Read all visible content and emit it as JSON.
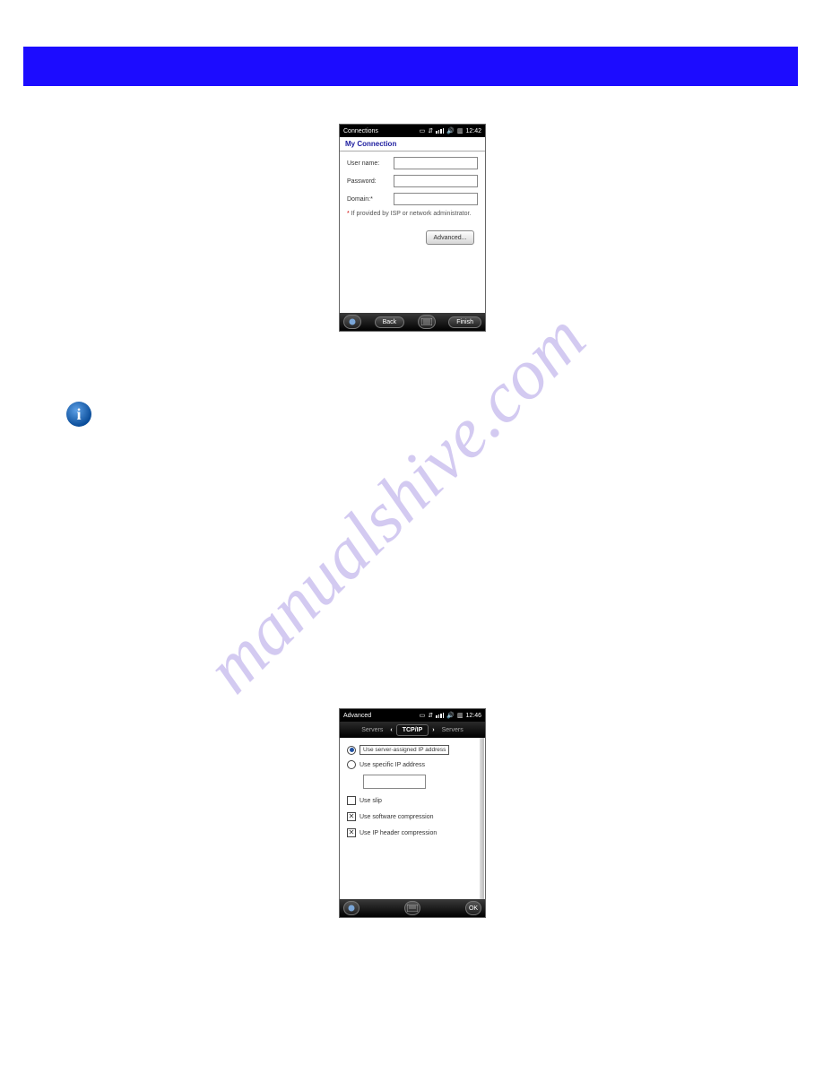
{
  "watermark": "manualshive.com",
  "info_icon_glyph": "i",
  "phone1": {
    "title": "Connections",
    "status": {
      "clock": "12:42"
    },
    "subheader": "My Connection",
    "labels": {
      "user": "User name:",
      "password": "Password:",
      "domain": "Domain:*"
    },
    "hint_star": "*",
    "hint_text": " If provided by ISP or network administrator.",
    "advanced_btn": "Advanced...",
    "nav": {
      "back": "Back",
      "finish": "Finish"
    }
  },
  "phone2": {
    "title": "Advanced",
    "status": {
      "clock": "12:46"
    },
    "tabs": {
      "left": "Servers",
      "center": "TCP/IP",
      "right": "Servers"
    },
    "options": {
      "server_assigned": "Use server-assigned IP address",
      "specific_ip": "Use specific IP address",
      "ip_placeholder": " ",
      "use_slip": "Use slip",
      "sw_compression": "Use software compression",
      "hdr_compression": "Use IP header compression"
    },
    "ok": "OK"
  }
}
